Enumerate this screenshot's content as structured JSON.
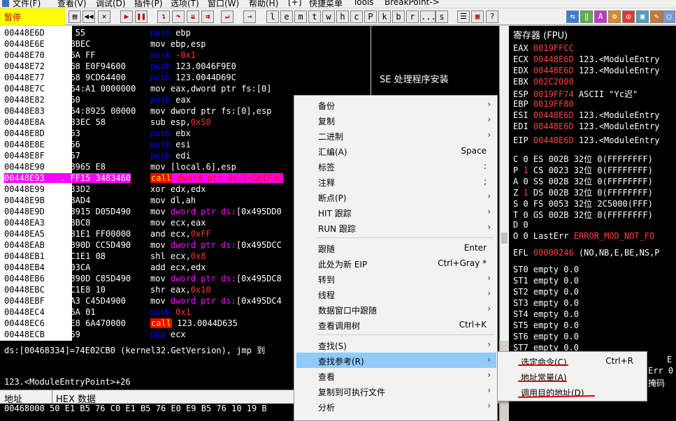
{
  "menubar": {
    "items": [
      "文件(F)",
      "查看(V)",
      "调试(D)",
      "插件(P)",
      "选项(T)",
      "窗口(W)",
      "帮助(H)",
      "[+]",
      "快捷菜单",
      "Tools",
      "BreakPoint->"
    ]
  },
  "toolbar": {
    "status": "暂停",
    "letter_buttons": [
      "l",
      "e",
      "m",
      "t",
      "w",
      "h",
      "c",
      "P",
      "k",
      "b",
      "r",
      "...",
      "s"
    ]
  },
  "disasm": {
    "rows": [
      {
        "addr": "00448E6D",
        "bytes": "┌$  55",
        "instr": "push ebp",
        "color": "blue"
      },
      {
        "addr": "00448E6E",
        "bytes": ".  8BEC",
        "instr": "mov ebp,esp",
        "color": "white"
      },
      {
        "addr": "00448E70",
        "bytes": ".  6A FF",
        "instr": "push -0x1",
        "color": "blue"
      },
      {
        "addr": "00448E72",
        "bytes": ".  68 E0F94600",
        "instr": "push 123.0046F9E0",
        "color": "blue"
      },
      {
        "addr": "00448E77",
        "bytes": ".  68 9CD64400",
        "instr": "push 123.0044D69C",
        "color": "blue"
      },
      {
        "addr": "00448E7C",
        "bytes": ".  64:A1 0000000",
        "instr": "mov eax,dword ptr fs:[0]",
        "color": "white"
      },
      {
        "addr": "00448E82",
        "bytes": ".  50",
        "instr": "push eax",
        "color": "blue"
      },
      {
        "addr": "00448E83",
        "bytes": ".  64:8925 00000",
        "instr": "mov dword ptr fs:[0],esp",
        "color": "white"
      },
      {
        "addr": "00448E8A",
        "bytes": ".  83EC 58",
        "instr": "sub esp,0x58",
        "color": "white"
      },
      {
        "addr": "00448E8D",
        "bytes": ".  53",
        "instr": "push ebx",
        "color": "blue"
      },
      {
        "addr": "00448E8E",
        "bytes": ".  56",
        "instr": "push esi",
        "color": "blue"
      },
      {
        "addr": "00448E8F",
        "bytes": ".  57",
        "instr": "push edi",
        "color": "blue"
      },
      {
        "addr": "00448E90",
        "bytes": ".  8965 E8",
        "instr": "mov [local.6],esp",
        "color": "white"
      },
      {
        "addr": "00448E93",
        "bytes": ".  FF15 3483460",
        "instr": "call dword ptr ds:[<&KERNE",
        "color": "call",
        "selected": true
      },
      {
        "addr": "00448E99",
        "bytes": ".  33D2",
        "instr": "xor edx,edx",
        "color": "white"
      },
      {
        "addr": "00448E9B",
        "bytes": ".  8AD4",
        "instr": "mov dl,ah",
        "color": "white"
      },
      {
        "addr": "00448E9D",
        "bytes": ".  8915 D05D490",
        "instr": "mov dword ptr ds:[0x495DD0",
        "color": "white"
      },
      {
        "addr": "00448EA3",
        "bytes": ".  8BC8",
        "instr": "mov ecx,eax",
        "color": "white"
      },
      {
        "addr": "00448EA5",
        "bytes": ".  81E1 FF00000",
        "instr": "and ecx,0xFF",
        "color": "white"
      },
      {
        "addr": "00448EAB",
        "bytes": ".  890D CC5D490",
        "instr": "mov dword ptr ds:[0x495DCC",
        "color": "white"
      },
      {
        "addr": "00448EB1",
        "bytes": ".  C1E1 08",
        "instr": "shl ecx,0x8",
        "color": "white"
      },
      {
        "addr": "00448EB4",
        "bytes": ".  03CA",
        "instr": "add ecx,edx",
        "color": "white"
      },
      {
        "addr": "00448EB6",
        "bytes": ".  890D C85D490",
        "instr": "mov dword ptr ds:[0x495DC8",
        "color": "white"
      },
      {
        "addr": "00448EBC",
        "bytes": ".  C1E8 10",
        "instr": "shr eax,0x10",
        "color": "white"
      },
      {
        "addr": "00448EBF",
        "bytes": ".  A3 C45D4900",
        "instr": "mov dword ptr ds:[0x495DC4",
        "color": "white"
      },
      {
        "addr": "00448EC4",
        "bytes": ".  6A 01",
        "instr": "push 0x1",
        "color": "blue"
      },
      {
        "addr": "00448EC6",
        "bytes": ".  E8 6A470000",
        "instr": "call 123.0044D635",
        "color": "call"
      },
      {
        "addr": "00448ECB",
        "bytes": ".  59",
        "instr": "pop ecx",
        "color": "blue"
      }
    ]
  },
  "comment": "SE 处理程序安装",
  "info": {
    "line1": "ds:[00468334]=74E02CB0 (kernel32.GetVersion), jmp 到",
    "line2": "123.<ModuleEntryPoint>+26"
  },
  "dump": {
    "col_addr": "地址",
    "col_hex": "HEX 数据",
    "row": "00468000 50 E1 B5 76 C0 E1 B5 76 E0 E9 B5 76 10 19 B"
  },
  "registers": {
    "title": "寄存器 (FPU)",
    "gp": [
      {
        "name": "EAX",
        "value": "0019FFCC",
        "comment": ""
      },
      {
        "name": "ECX",
        "value": "00448E6D",
        "comment": "123.<ModuleEntry"
      },
      {
        "name": "EDX",
        "value": "00448E6D",
        "comment": "123.<ModuleEntry"
      },
      {
        "name": "EBX",
        "value": "002C2000",
        "comment": ""
      },
      {
        "name": "ESP",
        "value": "0019FF74",
        "comment": "ASCII \"Yc迟\""
      },
      {
        "name": "EBP",
        "value": "0019FF80",
        "comment": ""
      },
      {
        "name": "ESI",
        "value": "00448E6D",
        "comment": "123.<ModuleEntry"
      },
      {
        "name": "EDI",
        "value": "00448E6D",
        "comment": "123.<ModuleEntry"
      }
    ],
    "eip": {
      "name": "EIP",
      "value": "00448E6D",
      "comment": "123.<ModuleEntry"
    },
    "flags": [
      {
        "f": "C",
        "v": "0",
        "seg": "ES",
        "sv": "002B",
        "bits": "32位",
        "base": "0(FFFFFFFF)"
      },
      {
        "f": "P",
        "v": "1",
        "seg": "CS",
        "sv": "0023",
        "bits": "32位",
        "base": "0(FFFFFFFF)"
      },
      {
        "f": "A",
        "v": "0",
        "seg": "SS",
        "sv": "002B",
        "bits": "32位",
        "base": "0(FFFFFFFF)"
      },
      {
        "f": "Z",
        "v": "1",
        "seg": "DS",
        "sv": "002B",
        "bits": "32位",
        "base": "0(FFFFFFFF)"
      },
      {
        "f": "S",
        "v": "0",
        "seg": "FS",
        "sv": "0053",
        "bits": "32位",
        "base": "2C5000(FFF)"
      },
      {
        "f": "T",
        "v": "0",
        "seg": "GS",
        "sv": "002B",
        "bits": "32位",
        "base": "0(FFFFFFFF)"
      },
      {
        "f": "D",
        "v": "0",
        "seg": "",
        "sv": "",
        "bits": "",
        "base": ""
      },
      {
        "f": "O",
        "v": "0",
        "seg": "LastErr",
        "sv": "",
        "bits": "",
        "base": "ERROR_MOD_NOT_FO"
      }
    ],
    "efl": {
      "name": "EFL",
      "value": "00000246",
      "comment": "(NO,NB,E,BE,NS,P"
    },
    "st": [
      "ST0 empty 0.0",
      "ST1 empty 0.0",
      "ST2 empty 0.0",
      "ST3 empty 0.0",
      "ST4 empty 0.0",
      "ST5 empty 0.0",
      "ST6 empty 0.0",
      "ST7 empty 0.0"
    ],
    "bottom_right": [
      "E",
      "Err 0",
      "掩码"
    ]
  },
  "context_menu": {
    "items": [
      {
        "label": "备份",
        "shortcut": "",
        "arrow": true
      },
      {
        "label": "复制",
        "shortcut": "",
        "arrow": true
      },
      {
        "label": "二进制",
        "shortcut": "",
        "arrow": true
      },
      {
        "label": "汇编(A)",
        "shortcut": "Space",
        "arrow": false
      },
      {
        "label": "标签",
        "shortcut": ":",
        "arrow": false
      },
      {
        "label": "注释",
        "shortcut": ";",
        "arrow": false
      },
      {
        "label": "断点(P)",
        "shortcut": "",
        "arrow": true
      },
      {
        "label": "HIT 跟踪",
        "shortcut": "",
        "arrow": true
      },
      {
        "label": "RUN 跟踪",
        "shortcut": "",
        "arrow": true
      },
      {
        "label": "跟随",
        "shortcut": "Enter",
        "arrow": false
      },
      {
        "label": "此处为新 EIP",
        "shortcut": "Ctrl+Gray *",
        "arrow": false
      },
      {
        "label": "转到",
        "shortcut": "",
        "arrow": true
      },
      {
        "label": "线程",
        "shortcut": "",
        "arrow": true
      },
      {
        "label": "数据窗口中跟随",
        "shortcut": "",
        "arrow": true
      },
      {
        "label": "查看调用树",
        "shortcut": "Ctrl+K",
        "arrow": false
      },
      {
        "label": "查找(S)",
        "shortcut": "",
        "arrow": true
      },
      {
        "label": "查找参考(R)",
        "shortcut": "",
        "arrow": true,
        "highlighted": true
      },
      {
        "label": "查看",
        "shortcut": "",
        "arrow": true
      },
      {
        "label": "复制到可执行文件",
        "shortcut": "",
        "arrow": true
      },
      {
        "label": "分析",
        "shortcut": "",
        "arrow": true
      }
    ]
  },
  "submenu": {
    "items": [
      {
        "label": "选定命令(C)",
        "shortcut": "Ctrl+R"
      },
      {
        "label": "地址常量(A)",
        "shortcut": ""
      },
      {
        "label": "调用目的地址(D)",
        "shortcut": ""
      }
    ]
  },
  "colors": {
    "status_bg": "#ffff00",
    "selected_row": "#ff00ff",
    "menu_highlight": "#91c9f7",
    "annotation_underline": "#e00000"
  }
}
